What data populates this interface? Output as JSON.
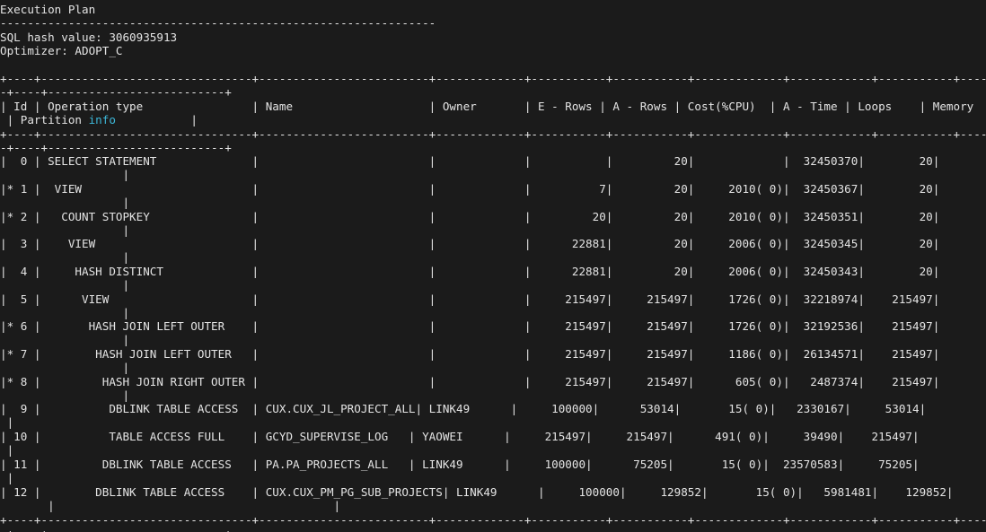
{
  "terminal": {
    "colors": {
      "background": "#1b1b1b",
      "foreground": "#e4e4e4",
      "highlight": "#3db7d8"
    },
    "lines": [
      "Execution Plan",
      "----------------------------------------------------------------",
      "SQL hash value: 3060935913",
      "Optimizer: ADOPT_C",
      "+----+-------------------------------+-------------------------+-------------+-----------+-----------+-------------+------------+-----------+-----------+",
      "-+----+--------------------------+",
      "| Id | Operation type                | Name                    | Owner       | E - Rows | A - Rows | Cost(%CPU)  | A - Time | Loops    | Memory",
      " | Partition ",
      "info",
      "           |",
      "+----+-------------------------------+-------------------------+-------------+-----------+-----------+-------------+------------+-----------+-----------+",
      "-+----+--------------------------+",
      "|  0 | SELECT STATEMENT              |                         |             |           |         20|             |  32450370|        20|",
      "                  |",
      "|* 1 |  VIEW                         |                         |             |          7|         20|     2010( 0)|  32450367|        20|",
      "                  |",
      "|* 2 |   COUNT STOPKEY               |                         |             |         20|         20|     2010( 0)|  32450351|        20|",
      "                  |",
      "|  3 |    VIEW                       |                         |             |      22881|         20|     2006( 0)|  32450345|        20|",
      "                  |",
      "|  4 |     HASH DISTINCT             |                         |             |      22881|         20|     2006( 0)|  32450343|        20|",
      "                  |",
      "|  5 |      VIEW                     |                         |             |     215497|     215497|     1726( 0)|  32218974|    215497|",
      "                  |",
      "|* 6 |       HASH JOIN LEFT OUTER    |                         |             |     215497|     215497|     1726( 0)|  32192536|    215497|",
      "                  |",
      "|* 7 |        HASH JOIN LEFT OUTER   |                         |             |     215497|     215497|     1186( 0)|  26134571|    215497|",
      "                  |",
      "|* 8 |         HASH JOIN RIGHT OUTER |                         |             |     215497|     215497|      605( 0)|   2487374|    215497|",
      "                  |",
      "|  9 |          DBLINK TABLE ACCESS  | CUX.CUX_JL_PROJECT_ALL| LINK49      |     100000|      53014|       15( 0)|   2330167|     53014|",
      " |",
      "| 10 |          TABLE ACCESS FULL    | GCYD_SUPERVISE_LOG   | YAOWEI      |     215497|     215497|      491( 0)|     39490|    215497|",
      " |",
      "| 11 |         DBLINK TABLE ACCESS   | PA.PA_PROJECTS_ALL   | LINK49      |     100000|      75205|       15( 0)|  23570583|     75205|",
      " |",
      "| 12 |        DBLINK TABLE ACCESS    | CUX.CUX_PM_PG_SUB_PROJECTS| LINK49      |     100000|     129852|       15( 0)|   5981481|    129852|",
      "       |                                         |",
      "+----+-------------------------------+-------------------------+-------------+-----------+-----------+-------------+------------+-----------+-----------+",
      "-+----+--------------------------+"
    ]
  }
}
